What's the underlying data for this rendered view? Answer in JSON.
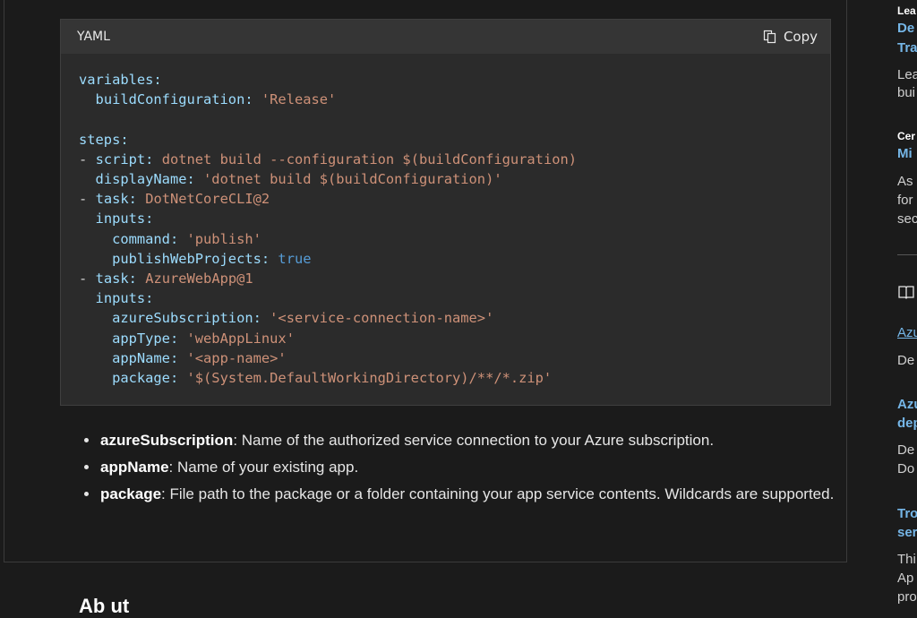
{
  "code_block": {
    "language": "YAML",
    "copy_label": "Copy"
  },
  "bullets": [
    {
      "term": "azureSubscription",
      "desc": ": Name of the authorized service connection to your Azure subscription."
    },
    {
      "term": "appName",
      "desc": ": Name of your existing app."
    },
    {
      "term": "package",
      "desc": ": File path to the package or a folder containing your app service contents. Wildcards are supported."
    }
  ],
  "bottom_heading": "Ab   ut",
  "sidebar": {
    "items": [
      {
        "text": "Lea"
      },
      {
        "text": "De"
      },
      {
        "text": "Tra"
      },
      {
        "text": "Lea"
      },
      {
        "text": "bui"
      },
      {
        "text": "Cer"
      },
      {
        "text": "Mi"
      },
      {
        "text": "As"
      },
      {
        "text": "for"
      },
      {
        "text": "sec"
      },
      {
        "text": "Azu"
      },
      {
        "text": "De"
      },
      {
        "text": "Azu"
      },
      {
        "text": "dep"
      },
      {
        "text": "De"
      },
      {
        "text": "Do"
      },
      {
        "text": "Tro"
      },
      {
        "text": "ser"
      },
      {
        "text": "Thi"
      },
      {
        "text": "Ap"
      },
      {
        "text": "pro"
      }
    ]
  },
  "colors": {
    "background": "#1b1b1b",
    "key": "#9cdcfe",
    "string": "#ce9178",
    "boolean": "#569cd6",
    "link": "#75b6e7"
  },
  "icons": [
    "copy-icon",
    "book-icon"
  ]
}
